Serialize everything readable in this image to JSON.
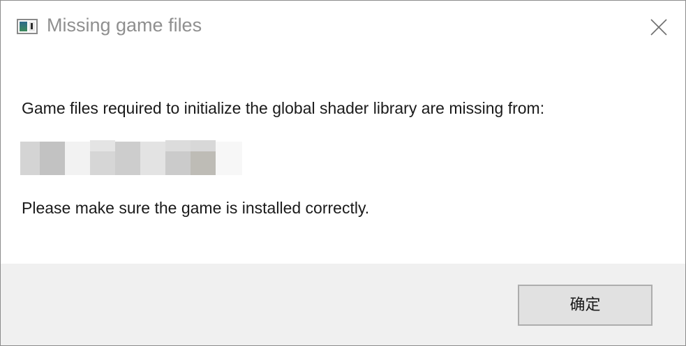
{
  "dialog": {
    "title": "Missing game files",
    "app_icon": "window-app-icon",
    "close_icon": "close-icon"
  },
  "message": {
    "line1": "Game files required to initialize the global shader library are missing from:",
    "path_redacted": true,
    "line2": "Please make sure the game is installed correctly."
  },
  "buttons": {
    "ok_label": "确定"
  }
}
